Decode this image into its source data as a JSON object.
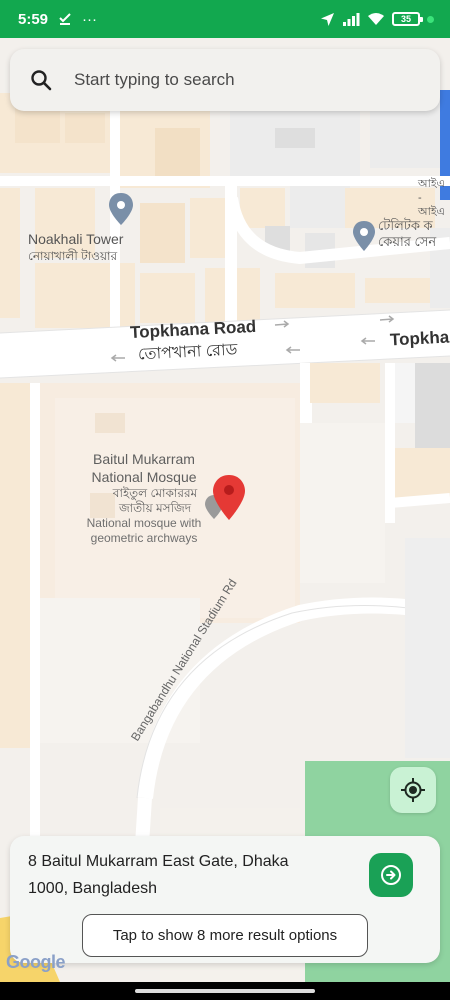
{
  "status_bar": {
    "time": "5:59",
    "dots": "···",
    "battery": "35"
  },
  "search": {
    "placeholder": "Start typing to search"
  },
  "map": {
    "pois": {
      "noakhali_tower": {
        "name": "Noakhali Tower",
        "name_bn": "নোয়াখালী টাওয়ার"
      },
      "teletalk": {
        "name_bn_1": "টেলিটক ক",
        "name_bn_2": "কেয়ার সেন"
      },
      "ai_label": {
        "line1": "আইএ",
        "line2": "- আইএ"
      }
    },
    "roads": {
      "topkhana": "Topkhana Road",
      "topkhana_bn": "তোপখানা রোড",
      "topkha_cut": "Topkha",
      "stadium_road": "Bangabandhu National Stadium Rd"
    },
    "mosque": {
      "name_line1": "Baitul Mukarram",
      "name_line2": "National Mosque",
      "name_bn_1": "বাইতুল মোকাররম",
      "name_bn_2": "জাতীয় মসজিদ",
      "desc_line1": "National mosque with",
      "desc_line2": "geometric archways"
    },
    "colors": {
      "land": "#f3f0ec",
      "building": "#f7e9d5",
      "road": "#ffffff",
      "park": "#8fd3a0",
      "pin": "#e53935"
    }
  },
  "result": {
    "address_line1": "8 Baitul Mukarram East Gate, Dhaka",
    "address_line2": "1000, Bangladesh",
    "more_options_label": "Tap to show 8 more result options"
  },
  "google_logo": "Google",
  "icons": {
    "search": "search-icon",
    "locate": "my-location-icon",
    "go": "arrow-right-circle-icon",
    "pin": "map-pin-icon"
  }
}
